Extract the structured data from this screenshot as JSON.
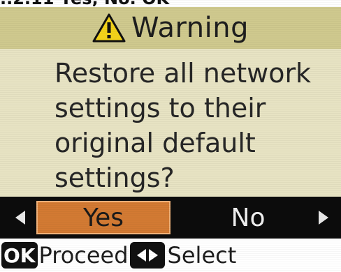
{
  "top_caption": "..2.11 Yes, No. OK",
  "dialog": {
    "title": "Warning",
    "title_icon": "warning-triangle-icon",
    "message_lines": [
      "Restore all network",
      "settings to their",
      "original default",
      "settings?"
    ]
  },
  "options": {
    "items": [
      "Yes",
      "No"
    ],
    "selected": "Yes",
    "left_icon": "arrow-left-icon",
    "right_icon": "arrow-right-icon"
  },
  "footer": {
    "ok_key": "OK",
    "ok_action": "Proceed",
    "lr_key_icon": "left-right-keys-icon",
    "lr_action": "Select"
  },
  "colors": {
    "title_bar": "#cfc98e",
    "message_bg": "#e7e3c3",
    "select_bar": "#0c0c0c",
    "selected_option": "#d27a33",
    "warning_yellow": "#f2d21a"
  }
}
